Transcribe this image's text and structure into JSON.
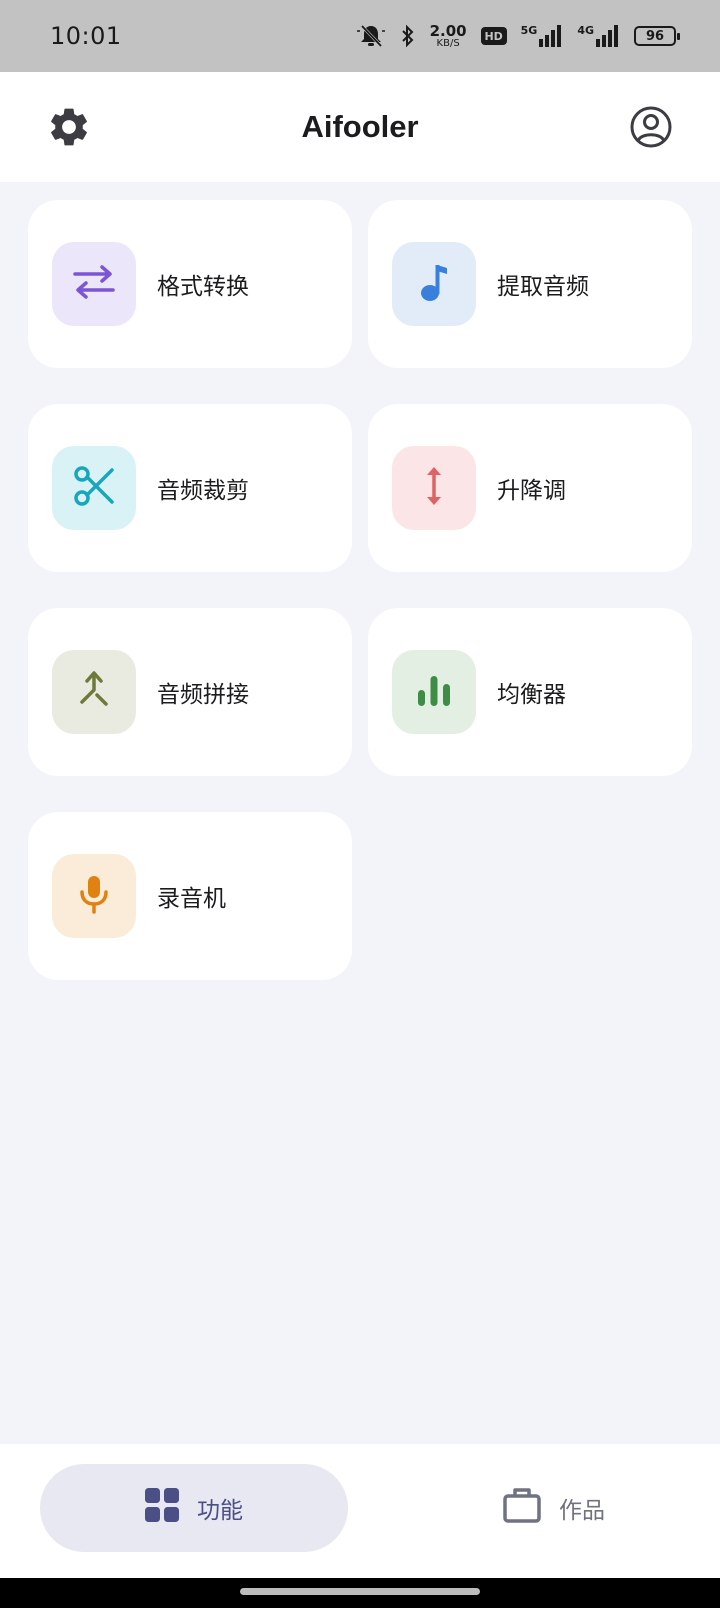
{
  "status_bar": {
    "time": "10:01",
    "net_speed_value": "2.00",
    "net_speed_unit": "KB/S",
    "hd_label": "HD",
    "sig1_label": "5G",
    "sig2_label": "4G",
    "battery": "96"
  },
  "app_bar": {
    "title": "Aifooler",
    "left_icon": "gear-icon",
    "right_icon": "account-circle-icon"
  },
  "features": [
    {
      "label": "格式转换",
      "icon": "swap-arrows-icon",
      "bg": "#ece6fb",
      "fg": "#7b55d6"
    },
    {
      "label": "提取音频",
      "icon": "music-note-icon",
      "bg": "#e2ecf9",
      "fg": "#3a7fdc"
    },
    {
      "label": "音频裁剪",
      "icon": "scissors-icon",
      "bg": "#d9f2f6",
      "fg": "#18a6bc"
    },
    {
      "label": "升降调",
      "icon": "vertical-arrows-icon",
      "bg": "#fbe5e6",
      "fg": "#e06262"
    },
    {
      "label": "音频拼接",
      "icon": "merge-icon",
      "bg": "#e9ebe0",
      "fg": "#6e7a3b"
    },
    {
      "label": "均衡器",
      "icon": "equalizer-bars-icon",
      "bg": "#e3efe2",
      "fg": "#3f8c47"
    },
    {
      "label": "录音机",
      "icon": "microphone-icon",
      "bg": "#fbebd9",
      "fg": "#e0820f"
    }
  ],
  "bottom_nav": {
    "tab_functions": "功能",
    "tab_works": "作品",
    "active_color": "#4b4f86",
    "inactive_color": "#6f7280"
  }
}
